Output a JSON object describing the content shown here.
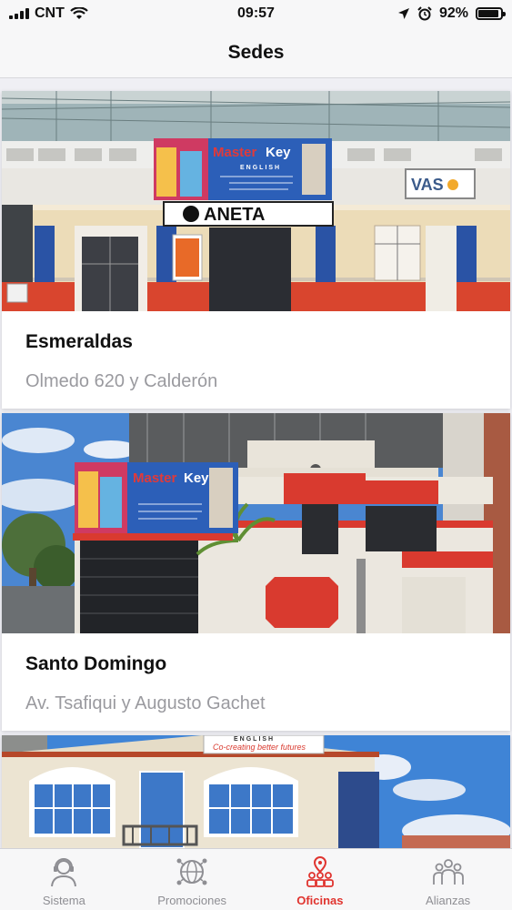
{
  "status_bar": {
    "carrier": "CNT",
    "time": "09:57",
    "battery": "92%",
    "battery_level": 0.92
  },
  "nav": {
    "title": "Sedes"
  },
  "offices": [
    {
      "name": "Esmeraldas",
      "address": "Olmedo 620 y Calderón",
      "sign_texts": [
        "Master",
        "Key",
        "ENGLISH",
        "ANETA",
        "VAS"
      ]
    },
    {
      "name": "Santo Domingo",
      "address": "Av. Tsafiqui y Augusto Gachet",
      "sign_texts": [
        "Master",
        "Key"
      ]
    },
    {
      "name": "",
      "address": "",
      "sign_texts": [
        "ENGLISH",
        "Co-creating better futures"
      ]
    }
  ],
  "tabs": [
    {
      "label": "Sistema",
      "icon": "support-agent-icon",
      "active": false
    },
    {
      "label": "Promociones",
      "icon": "globe-network-icon",
      "active": false
    },
    {
      "label": "Oficinas",
      "icon": "office-location-icon",
      "active": true
    },
    {
      "label": "Alianzas",
      "icon": "alliance-people-icon",
      "active": false
    }
  ],
  "colors": {
    "accent": "#e0342f",
    "inactive": "#8e8e93"
  }
}
